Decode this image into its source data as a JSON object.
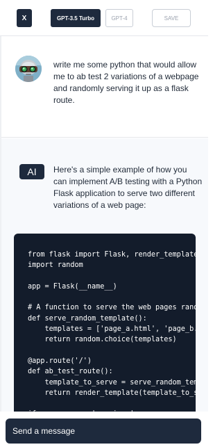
{
  "topbar": {
    "close_label": "X",
    "models": [
      {
        "label": "GPT-3.5 Turbo",
        "selected": true
      },
      {
        "label": "GPT-4",
        "selected": false
      }
    ],
    "save_label": "SAVE"
  },
  "conversation": {
    "user_message": {
      "avatar_icon": "robot-avatar-icon",
      "text": "write me some python that would allow me to ab test 2 variations of a webpage and randomly serving it up as a flask route."
    },
    "assistant_message": {
      "badge": "AI",
      "text": "Here's a simple example of how you can implement A/B testing with a Python Flask application to serve two different variations of a web page:",
      "code": "from flask import Flask, render_template\nimport random\n\napp = Flask(__name__)\n\n# A function to serve the web pages randomly\ndef serve_random_template():\n    templates = ['page_a.html', 'page_b.html']\n    return random.choice(templates)\n\n@app.route('/')\ndef ab_test_route():\n    template_to_serve = serve_random_template()\n    return render_template(template_to_serve)\n\nif __name__ == '__main__':\n    app.run(debug=True)"
    }
  },
  "composer": {
    "placeholder": "Send a message"
  },
  "colors": {
    "navy": "#1e2a3d",
    "code_bg": "#131c2b",
    "ai_bg": "#f7f9fc",
    "border": "#e5e7eb"
  }
}
